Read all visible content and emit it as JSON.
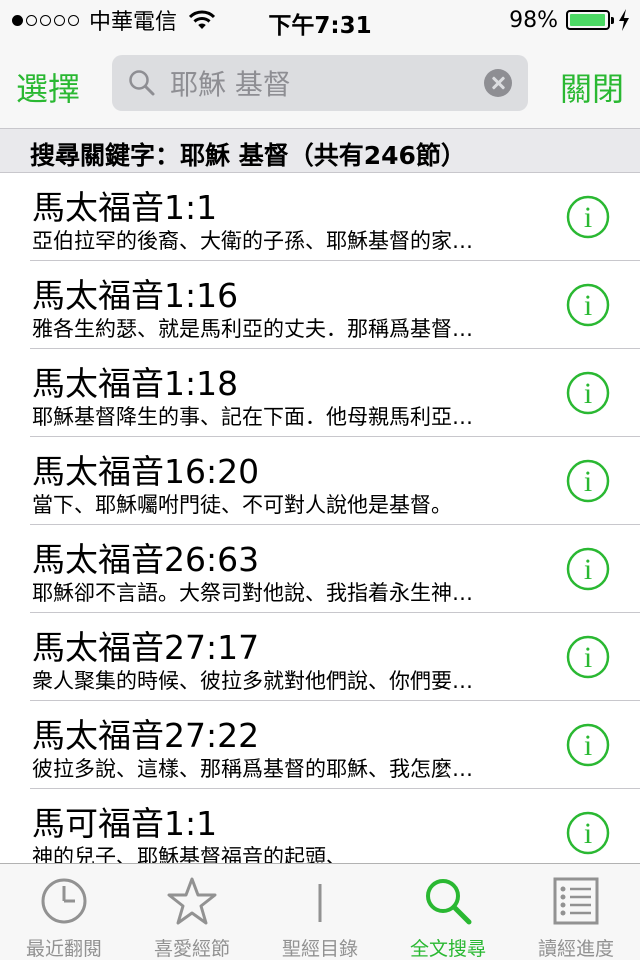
{
  "status_bar": {
    "signal_dots": [
      true,
      false,
      false,
      false,
      false
    ],
    "carrier": "中華電信",
    "time": "下午7:31",
    "battery_percent": "98%",
    "battery_level": 0.98,
    "wifi_icon": "wifi-icon",
    "charging_icon": "lightning-bolt-icon"
  },
  "nav": {
    "left_button": "選擇",
    "right_button": "關閉",
    "search": {
      "value": "耶穌 基督",
      "search_icon": "magnifier-icon",
      "clear_icon": "clear-x-icon"
    }
  },
  "section_header": "搜尋關鍵字：耶穌 基督（共有246節）",
  "results": [
    {
      "ref": "馬太福音1:1",
      "snippet": "亞伯拉罕的後裔、大衛的子孫、耶穌基督的家…"
    },
    {
      "ref": "馬太福音1:16",
      "snippet": "雅各生約瑟、就是馬利亞的丈夫．那稱爲基督…"
    },
    {
      "ref": "馬太福音1:18",
      "snippet": "耶穌基督降生的事、記在下面．他母親馬利亞…"
    },
    {
      "ref": "馬太福音16:20",
      "snippet": "當下、耶穌囑咐門徒、不可對人說他是基督。"
    },
    {
      "ref": "馬太福音26:63",
      "snippet": "耶穌卻不言語。大祭司對他說、我指着永生神…"
    },
    {
      "ref": "馬太福音27:17",
      "snippet": "衆人聚集的時候、彼拉多就對他們說、你們要…"
    },
    {
      "ref": "馬太福音27:22",
      "snippet": "彼拉多說、這樣、那稱爲基督的耶穌、我怎麼…"
    },
    {
      "ref": "馬可福音1:1",
      "snippet": "神的兒子、耶穌基督福音的起頭、"
    }
  ],
  "info_icon": "info-circle-icon",
  "tabs": [
    {
      "label": "最近翻閱",
      "icon": "clock-icon",
      "active": false
    },
    {
      "label": "喜愛經節",
      "icon": "star-icon",
      "active": false
    },
    {
      "label": "聖經目錄",
      "icon": "book-icon",
      "active": false
    },
    {
      "label": "全文搜尋",
      "icon": "search-icon",
      "active": true
    },
    {
      "label": "讀經進度",
      "icon": "checklist-icon",
      "active": false
    }
  ],
  "colors": {
    "accent": "#2ab832",
    "inactive": "#929292",
    "battery": "#4cd964"
  }
}
